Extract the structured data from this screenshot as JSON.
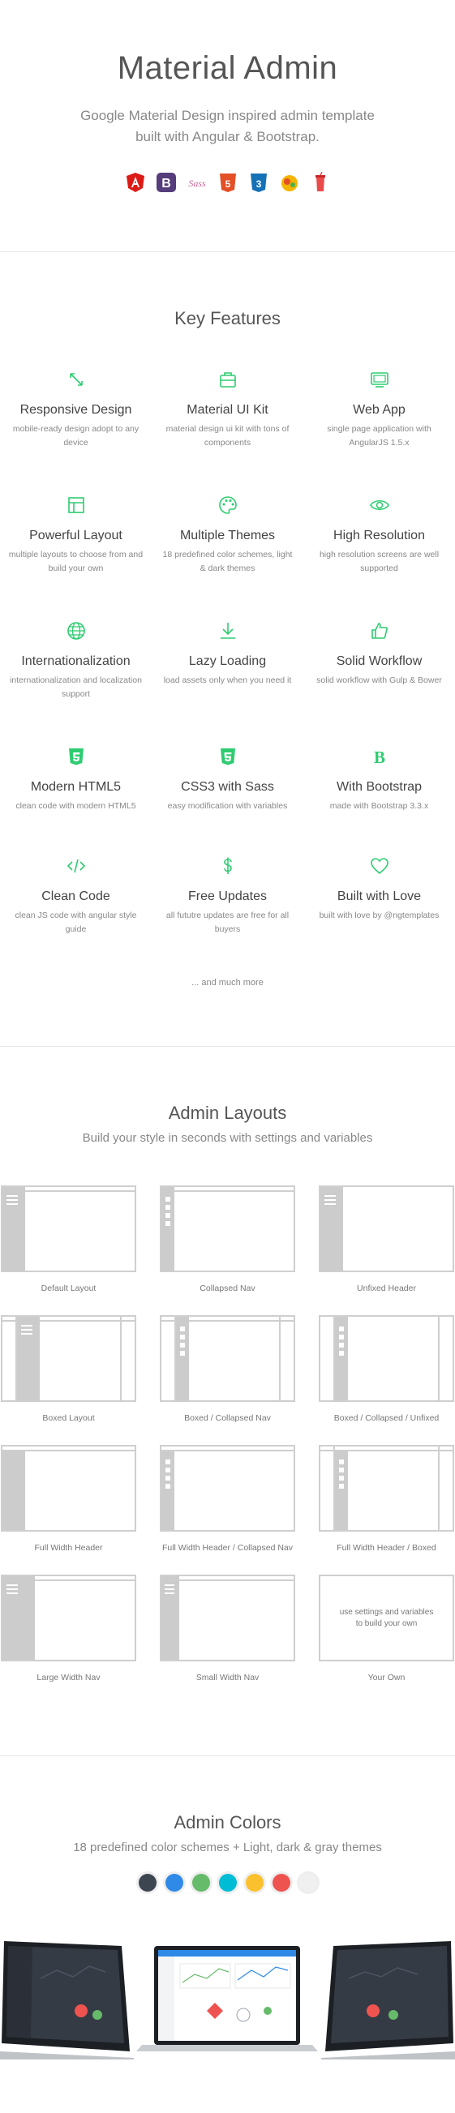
{
  "hero": {
    "title": "Material Admin",
    "subtitle_line1": "Google Material Design inspired admin template",
    "subtitle_line2": "built with Angular & Bootstrap.",
    "tech_icons": [
      "angular-icon",
      "bootstrap-icon",
      "sass-icon",
      "html5-icon",
      "css3-icon",
      "gulp-icon",
      "bower-icon"
    ]
  },
  "features": {
    "title": "Key Features",
    "accent": "#2ecc71",
    "items": [
      {
        "icon": "resize-arrows-icon",
        "title": "Responsive Design",
        "desc": "mobile-ready design adopt to any device"
      },
      {
        "icon": "briefcase-icon",
        "title": "Material UI Kit",
        "desc": "material design ui kit with tons of components"
      },
      {
        "icon": "browser-window-icon",
        "title": "Web App",
        "desc": "single page application with AngularJS 1.5.x"
      },
      {
        "icon": "layout-icon",
        "title": "Powerful Layout",
        "desc": "multiple layouts to choose from and build your own"
      },
      {
        "icon": "palette-icon",
        "title": "Multiple Themes",
        "desc": "18 predefined color schemes, light & dark themes"
      },
      {
        "icon": "eye-icon",
        "title": "High Resolution",
        "desc": "high resolution screens are well supported"
      },
      {
        "icon": "globe-icon",
        "title": "Internationalization",
        "desc": "internationalization and localization support"
      },
      {
        "icon": "download-icon",
        "title": "Lazy Loading",
        "desc": "load assets only when you need it"
      },
      {
        "icon": "thumbs-up-icon",
        "title": "Solid Workflow",
        "desc": "solid workflow with Gulp & Bower"
      },
      {
        "icon": "html5-icon",
        "title": "Modern HTML5",
        "desc": "clean code with modern HTML5"
      },
      {
        "icon": "css3-icon",
        "title": "CSS3 with Sass",
        "desc": "easy modification with variables"
      },
      {
        "icon": "bootstrap-icon",
        "title": "With Bootstrap",
        "desc": "made with Bootstrap 3.3.x"
      },
      {
        "icon": "code-icon",
        "title": "Clean Code",
        "desc": "clean JS code with angular style guide"
      },
      {
        "icon": "dollar-icon",
        "title": "Free Updates",
        "desc": "all fututre updates are free for all buyers"
      },
      {
        "icon": "heart-icon",
        "title": "Built with Love",
        "desc": "built with love by @ngtemplates"
      }
    ],
    "more": "... and much more"
  },
  "layouts": {
    "title": "Admin Layouts",
    "subtitle": "Build your style in seconds with settings and variables",
    "items": [
      "Default Layout",
      "Collapsed Nav",
      "Unfixed Header",
      "Boxed Layout",
      "Boxed / Collapsed Nav",
      "Boxed / Collapsed / Unfixed",
      "Full Width Header",
      "Full Width Header / Collapsed Nav",
      "Full Width Header / Boxed",
      "Large Width Nav",
      "Small Width Nav",
      "Your Own"
    ],
    "own_text": "use settings and variables to build your own"
  },
  "colors": {
    "title": "Admin Colors",
    "subtitle": "18 predefined color schemes + Light, dark & gray themes",
    "swatches": [
      "#3d4551",
      "#2e8ae6",
      "#66bb6a",
      "#00bcd4",
      "#fbc02d",
      "#ef5350",
      "#f0f0f0"
    ]
  }
}
